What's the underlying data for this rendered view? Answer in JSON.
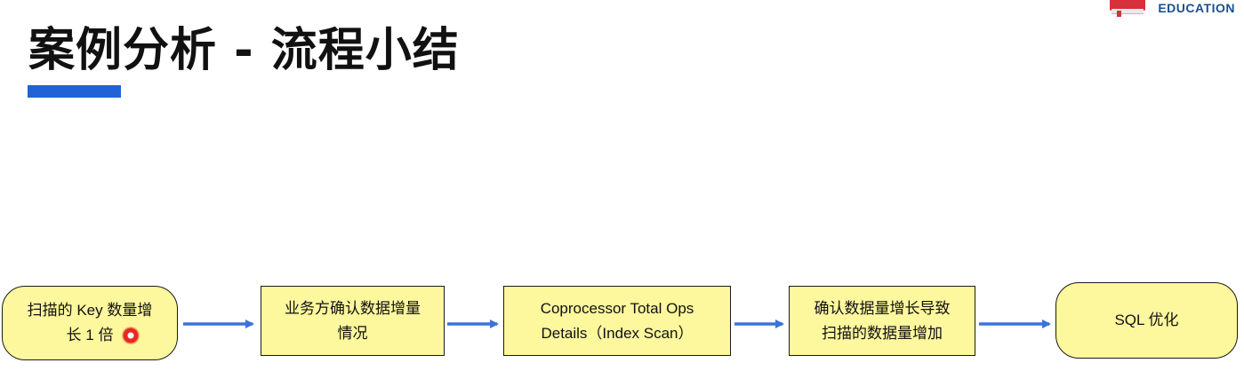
{
  "header": {
    "title": "案例分析 - 流程小结",
    "accent_color": "#1f63d6"
  },
  "logo": {
    "text": "EDUCATION",
    "icon": "book-icon",
    "brand_color": "#d6303a"
  },
  "flow": {
    "node_fill": "#fdf79d",
    "arrow_color": "#3b73d9",
    "nodes": [
      {
        "line1": "扫描的 Key 数量增",
        "line2": "长 1 倍"
      },
      {
        "line1": "业务方确认数据增量",
        "line2": "情况"
      },
      {
        "line1": "Coprocessor Total Ops",
        "line2": "Details（Index Scan）"
      },
      {
        "line1": "确认数据量增长导致",
        "line2": "扫描的数据量增加"
      },
      {
        "line1": "SQL 优化"
      }
    ]
  }
}
